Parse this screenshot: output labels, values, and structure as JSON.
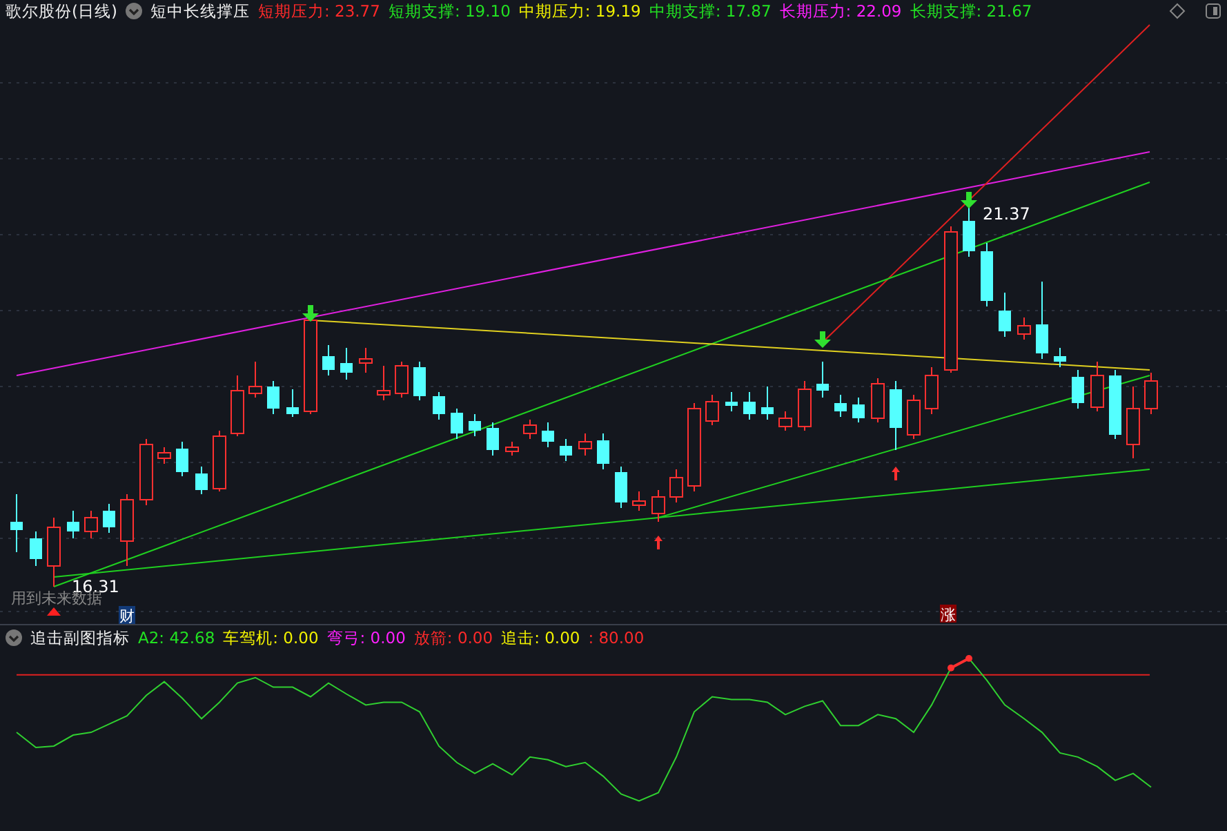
{
  "header": {
    "stock": "歌尔股份(日线)",
    "indicator": "短中长线撑压",
    "values": [
      {
        "text": "短期压力: 23.77",
        "color": "#ff2a2a"
      },
      {
        "text": "短期支撑: 19.10",
        "color": "#22e022"
      },
      {
        "text": "中期压力: 19.19",
        "color": "#f0f000"
      },
      {
        "text": "中期支撑: 17.87",
        "color": "#22e022"
      },
      {
        "text": "长期压力: 22.09",
        "color": "#ff20ff"
      },
      {
        "text": "长期支撑: 21.67",
        "color": "#22e022"
      }
    ]
  },
  "main_chart": {
    "high_label": "21.37",
    "low_label": "16.31",
    "note": "用到未来数据",
    "badges": [
      {
        "text": "财",
        "kind": "finance"
      },
      {
        "text": "涨",
        "kind": "rise"
      }
    ]
  },
  "sub_chart": {
    "title": "追击副图指标",
    "values": [
      {
        "text": "A2: 42.68",
        "color": "#22e022"
      },
      {
        "text": "车驾机: 0.00",
        "color": "#f0f000"
      },
      {
        "text": "弯弓: 0.00",
        "color": "#ff20ff"
      },
      {
        "text": "放箭: 0.00",
        "color": "#ff2a2a"
      },
      {
        "text": "追击: 0.00",
        "color": "#f0f000"
      },
      {
        "text": ": 80.00",
        "color": "#ff2a2a"
      }
    ]
  }
}
